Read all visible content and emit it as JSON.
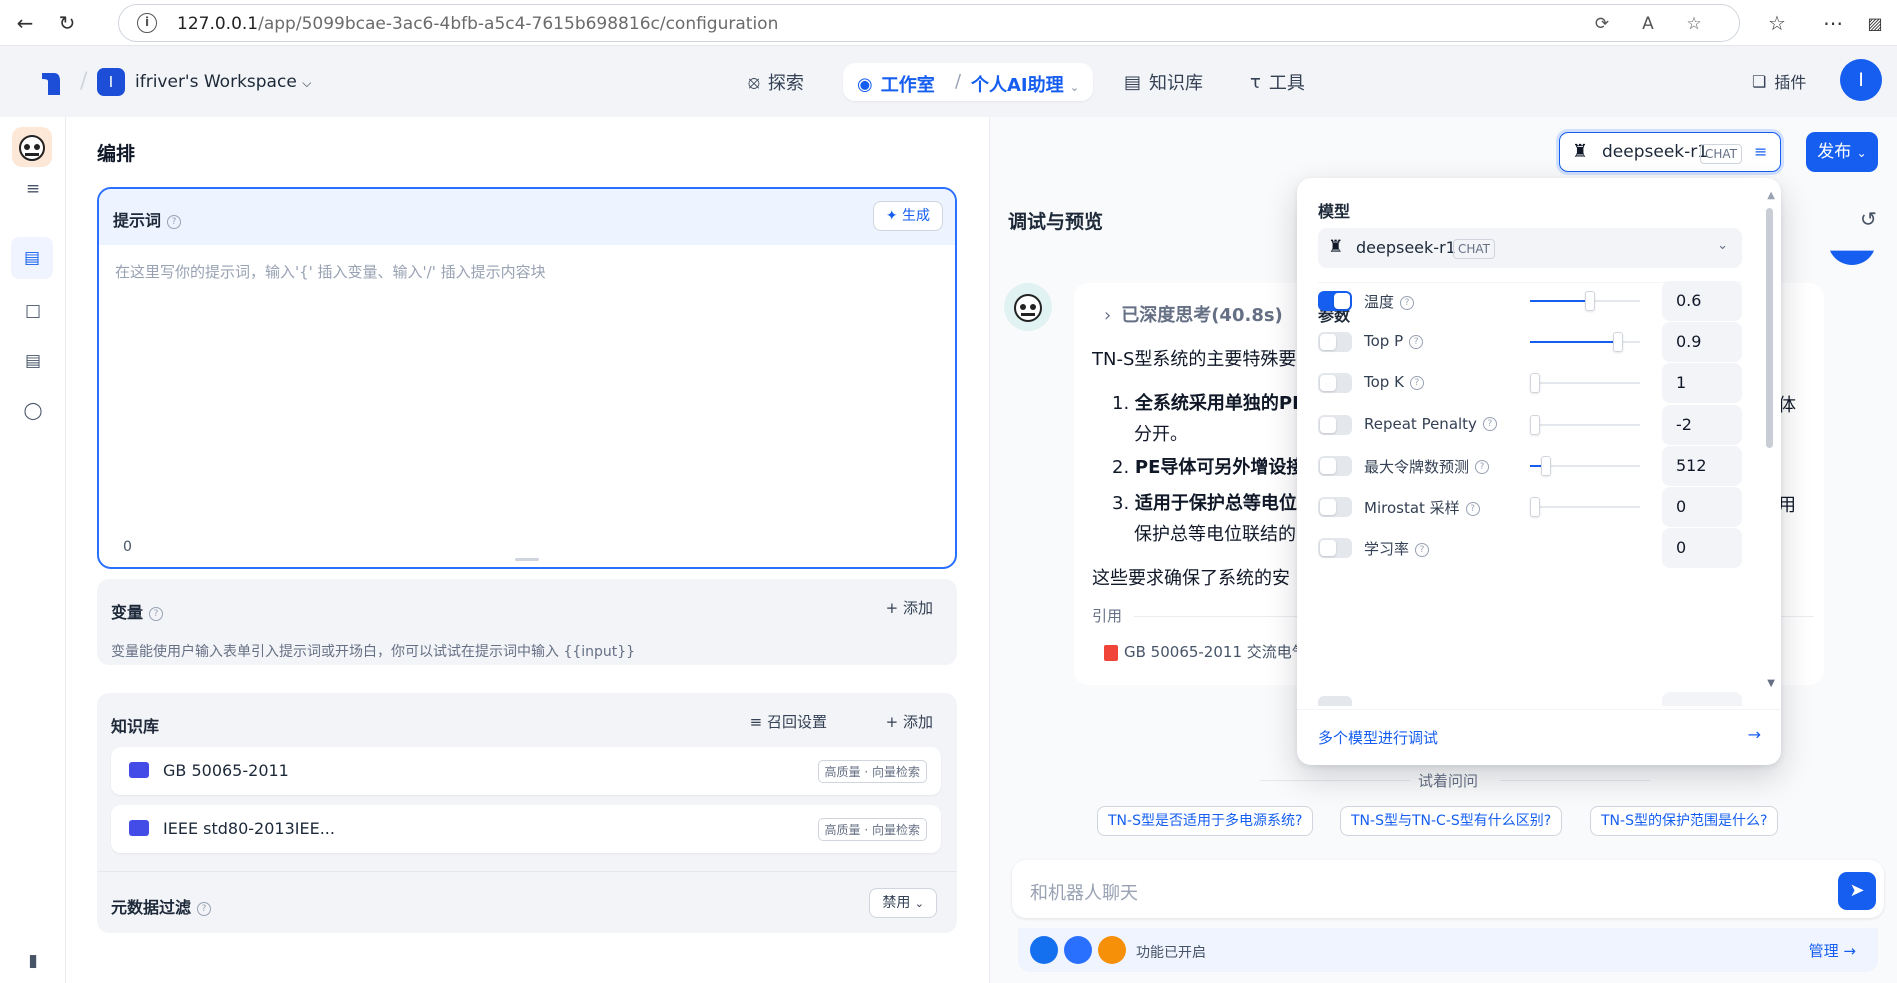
{
  "browser": {
    "url_host": "127.0.0.1",
    "url_path": "/app/5099bcae-3ac6-4bfb-a5c4-7615b698816c/configuration"
  },
  "header": {
    "workspace_badge": "I",
    "workspace_name": "ifriver's Workspace",
    "nav": {
      "explore": "探索",
      "studio": "工作室",
      "app_name": "个人AI助理",
      "knowledge": "知识库",
      "tools": "工具",
      "plugins": "插件"
    },
    "avatar": "I"
  },
  "main": {
    "title": "编排",
    "prompt": {
      "label": "提示词",
      "generate": "生成",
      "placeholder": "在这里写你的提示词，输入'{' 插入变量、输入'/' 插入提示内容块",
      "count": "0"
    },
    "variables": {
      "label": "变量",
      "add": "添加",
      "desc": "变量能使用户输入表单引入提示词或开场白，你可以试试在提示词中输入 {{input}}"
    },
    "knowledge": {
      "label": "知识库",
      "recall": "召回设置",
      "add": "添加",
      "items": [
        {
          "name": "GB 50065-2011",
          "tag": "高质量 · 向量检索"
        },
        {
          "name": "IEEE std80-2013IEE...",
          "tag": "高质量 · 向量检索"
        }
      ]
    },
    "metadata": {
      "label": "元数据过滤",
      "value": "禁用"
    }
  },
  "debug": {
    "title": "调试与预览",
    "model_button": {
      "name": "deepseek-r1",
      "tag": "CHAT"
    },
    "publish": "发布",
    "message": {
      "thinking": "已深度思考(40.8s)",
      "intro": "TN-S型系统的主要特殊要",
      "items": [
        {
          "num": "1.",
          "bold": "全系统采用单独的PI",
          "rest": ""
        },
        {
          "num": "",
          "bold": "",
          "rest": "分开。"
        },
        {
          "num": "2.",
          "bold": "PE导体可另外增设接",
          "rest": ""
        },
        {
          "num": "3.",
          "bold": "适用于保护总等电位",
          "rest": ""
        },
        {
          "num": "",
          "bold": "",
          "rest": "保护总等电位联结的"
        }
      ],
      "right_fragment_1": "体",
      "right_fragment_2": "用",
      "closing": "这些要求确保了系统的安",
      "cite_label": "引用",
      "cite_item": "GB 50065-2011 交流电气"
    },
    "try_label": "试着问问",
    "suggestions": [
      "TN-S型是否适用于多电源系统?",
      "TN-S型与TN-C-S型有什么区别?",
      "TN-S型的保护范围是什么?"
    ],
    "input_placeholder": "和机器人聊天",
    "features_label": "功能已开启",
    "manage": "管理"
  },
  "popover": {
    "model_label": "模型",
    "model_name": "deepseek-r1",
    "model_tag": "CHAT",
    "params_label": "参数",
    "params": [
      {
        "name": "温度",
        "enabled": true,
        "value": "0.6",
        "level": 0.6
      },
      {
        "name": "Top P",
        "enabled": false,
        "value": "0.9",
        "level": 0.9
      },
      {
        "name": "Top K",
        "enabled": false,
        "value": "1",
        "level": 0.0
      },
      {
        "name": "Repeat Penalty",
        "enabled": false,
        "value": "-2",
        "level": 0.0
      },
      {
        "name": "最大令牌数预测",
        "enabled": false,
        "value": "512",
        "level": 0.12
      },
      {
        "name": "Mirostat 采样",
        "enabled": false,
        "value": "0",
        "level": 0.0
      },
      {
        "name": "学习率",
        "enabled": false,
        "value": "0",
        "level": null
      }
    ],
    "multi_model": "多个模型进行调试"
  },
  "colors": {
    "accent": "#155eef",
    "accent_light": "#eff4ff"
  }
}
